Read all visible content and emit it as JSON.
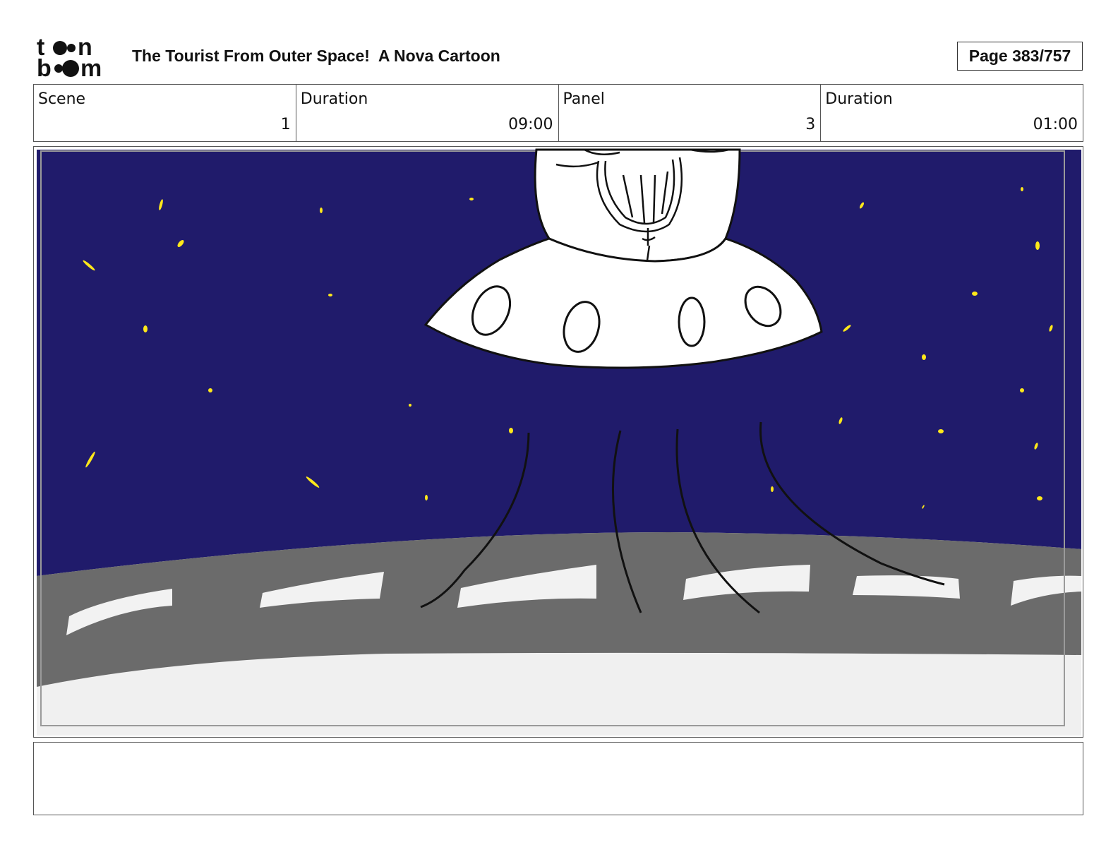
{
  "header": {
    "logo_text": "toon boom",
    "title": "The Tourist From Outer Space!  A Nova Cartoon",
    "page_label": "Page 383/757"
  },
  "meta": {
    "scene_label": "Scene",
    "scene_value": "1",
    "scene_duration_label": "Duration",
    "scene_duration_value": "09:00",
    "panel_label": "Panel",
    "panel_value": "3",
    "panel_duration_label": "Duration",
    "panel_duration_value": "01:00"
  },
  "panel_image": {
    "description_icon": "ufo-over-road-drawing",
    "colors": {
      "sky": "#201b6b",
      "star": "#ffe81a",
      "road": "#6b6b6b",
      "road_marking": "#f2f2f2",
      "ground": "#f0f0f0",
      "outline": "#111111"
    }
  },
  "notes": {
    "text": ""
  }
}
